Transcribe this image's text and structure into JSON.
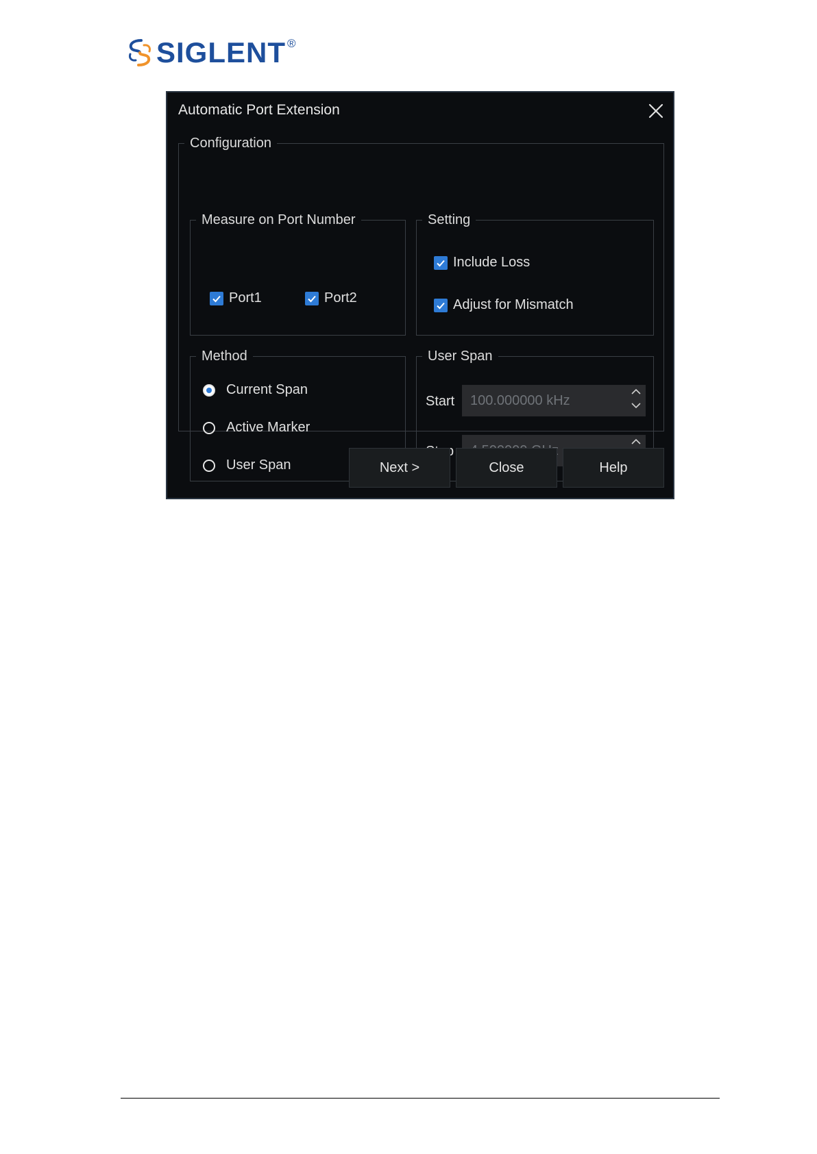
{
  "brand": {
    "name": "SIGLENT",
    "mark": "®",
    "color": "#1e4f9c",
    "accent": "#f0932b"
  },
  "dialog": {
    "title": "Automatic Port Extension",
    "configuration": {
      "legend": "Configuration",
      "measure_on_port": {
        "legend": "Measure on Port Number",
        "ports": [
          {
            "label": "Port1",
            "checked": true
          },
          {
            "label": "Port2",
            "checked": true
          }
        ]
      },
      "setting": {
        "legend": "Setting",
        "options": [
          {
            "label": "Include Loss",
            "checked": true
          },
          {
            "label": "Adjust for Mismatch",
            "checked": true
          }
        ]
      },
      "method": {
        "legend": "Method",
        "options": [
          {
            "label": "Current Span",
            "selected": true
          },
          {
            "label": "Active Marker",
            "selected": false
          },
          {
            "label": "User Span",
            "selected": false
          }
        ]
      },
      "user_span": {
        "legend": "User Span",
        "start_label": "Start",
        "start_value": "100.000000 kHz",
        "stop_label": "Stop",
        "stop_value": "4.500000 GHz"
      }
    },
    "buttons": {
      "next": "Next >",
      "close": "Close",
      "help": "Help"
    },
    "colors": {
      "background": "#0b0d10",
      "checkbox": "#2e7bd6",
      "input_bg": "#2a2b2e"
    }
  }
}
